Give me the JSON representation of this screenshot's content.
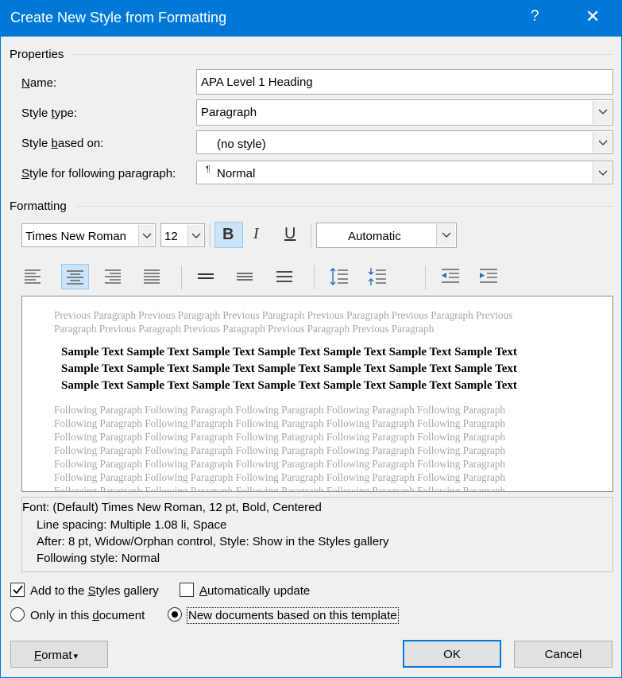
{
  "title": "Create New Style from Formatting",
  "help_glyph": "?",
  "close_glyph": "✕",
  "properties": {
    "label": "Properties",
    "name": {
      "label_u": "N",
      "label_rest": "ame:",
      "value": "APA Level 1 Heading"
    },
    "style_type": {
      "label_pre": "Style ",
      "label_u": "t",
      "label_rest": "ype:",
      "value": "Paragraph"
    },
    "based_on": {
      "label_pre": "Style ",
      "label_u": "b",
      "label_rest": "ased on:",
      "value": "(no style)"
    },
    "following": {
      "label_u": "S",
      "label_rest": "tyle for following paragraph:",
      "mark": "¶",
      "value": "Normal"
    }
  },
  "formatting": {
    "label": "Formatting",
    "font": "Times New Roman",
    "size": "12",
    "bold": "B",
    "italic": "I",
    "underline": "U",
    "color": "Automatic",
    "active_alignment": "center"
  },
  "preview": {
    "previous": [
      "Previous Paragraph Previous Paragraph Previous Paragraph Previous Paragraph Previous Paragraph Previous",
      "Paragraph Previous Paragraph Previous Paragraph Previous Paragraph Previous Paragraph"
    ],
    "sample": [
      "Sample Text Sample Text Sample Text Sample Text Sample Text Sample Text Sample Text",
      "Sample Text Sample Text Sample Text Sample Text Sample Text Sample Text Sample Text",
      "Sample Text Sample Text Sample Text Sample Text Sample Text Sample Text Sample Text"
    ],
    "following": [
      "Following Paragraph Following Paragraph Following Paragraph Following Paragraph Following Paragraph",
      "Following Paragraph Following Paragraph Following Paragraph Following Paragraph Following Paragraph",
      "Following Paragraph Following Paragraph Following Paragraph Following Paragraph Following Paragraph",
      "Following Paragraph Following Paragraph Following Paragraph Following Paragraph Following Paragraph",
      "Following Paragraph Following Paragraph Following Paragraph Following Paragraph Following Paragraph",
      "Following Paragraph Following Paragraph Following Paragraph Following Paragraph Following Paragraph",
      "Following Paragraph Following Paragraph Following Paragraph Following Paragraph Following Paragraph"
    ]
  },
  "description": {
    "line1": "Font: (Default) Times New Roman, 12 pt, Bold, Centered",
    "line2": "Line spacing:  Multiple 1.08 li, Space",
    "line3": "After:  8 pt, Widow/Orphan control, Style: Show in the Styles gallery",
    "line4": "Following style: Normal"
  },
  "options": {
    "add_gallery": {
      "pre": "Add to the ",
      "u": "S",
      "rest": "tyles gallery",
      "checked": true
    },
    "auto_update": {
      "u": "A",
      "rest": "utomatically update",
      "checked": false
    },
    "only_doc": {
      "pre": "Only in this ",
      "u": "d",
      "rest": "ocument",
      "selected": false
    },
    "new_docs": {
      "text": "New documents based on this template",
      "selected": true
    }
  },
  "buttons": {
    "format": {
      "u": "F",
      "rest": "ormat",
      "arrow": "▾"
    },
    "ok": "OK",
    "cancel": "Cancel"
  }
}
